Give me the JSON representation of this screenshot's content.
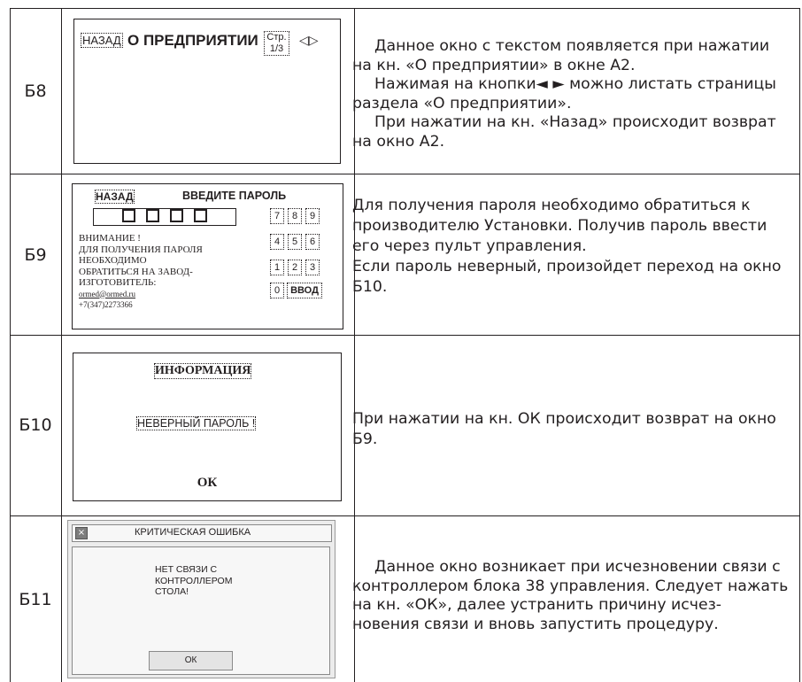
{
  "rows": [
    {
      "id": "Б8",
      "screen": {
        "back": "НАЗАД",
        "title": "О ПРЕДПРИЯТИИ",
        "page_label": "Стр.",
        "page_value": "1/3",
        "arrows": "◁▷"
      },
      "description": [
        "Данное окно с текстом появляется при нажатии на кн. «О предприятии» в окне А2.",
        "Нажимая на кнопки◄ ► можно листать страницы раздела «О предприятии».",
        "При нажатии на кн. «Назад» происходит возврат на окно А2."
      ]
    },
    {
      "id": "Б9",
      "screen": {
        "back": "НАЗАД",
        "title": "ВВЕДИТЕ ПАРОЛЬ",
        "notice": [
          "ВНИМАНИЕ !",
          "ДЛЯ ПОЛУЧЕНИЯ ПАРОЛЯ",
          "НЕОБХОДИМО",
          "ОБРАТИТЬСЯ НА ЗАВОД-",
          "ИЗГОТОВИТЕЛЬ:"
        ],
        "email": "ormed@ormed.ru",
        "phone": "+7(347)2273366",
        "keys": [
          "7",
          "8",
          "9",
          "4",
          "5",
          "6",
          "1",
          "2",
          "3",
          "0"
        ],
        "enter": "ВВОД"
      },
      "description": [
        "Для получения пароля необходимо обратиться к производителю Установки. Получив пароль ввести его через пульт управления.",
        "Если пароль неверный, произойдет переход на окно Б10."
      ]
    },
    {
      "id": "Б10",
      "screen": {
        "title": "ИНФОРМАЦИЯ",
        "message": "НЕВЕРНЫЙ ПАРОЛЬ !",
        "ok": "ОК"
      },
      "description": [
        "При нажатии на кн. ОК происходит возврат на окно Б9."
      ]
    },
    {
      "id": "Б11",
      "screen": {
        "title": "КРИТИЧЕСКАЯ ОШИБКА",
        "message": [
          "НЕТ СВЯЗИ С",
          "КОНТРОЛЛЕРОМ",
          "СТОЛА!"
        ],
        "ok": "ОК"
      },
      "description": [
        "Данное окно возникает при исчезновении связи с контроллером блока 38 управления. Следует нажать на кн. «ОК», далее устранить причину исчез- новения связи и вновь запустить процедуру."
      ]
    }
  ]
}
